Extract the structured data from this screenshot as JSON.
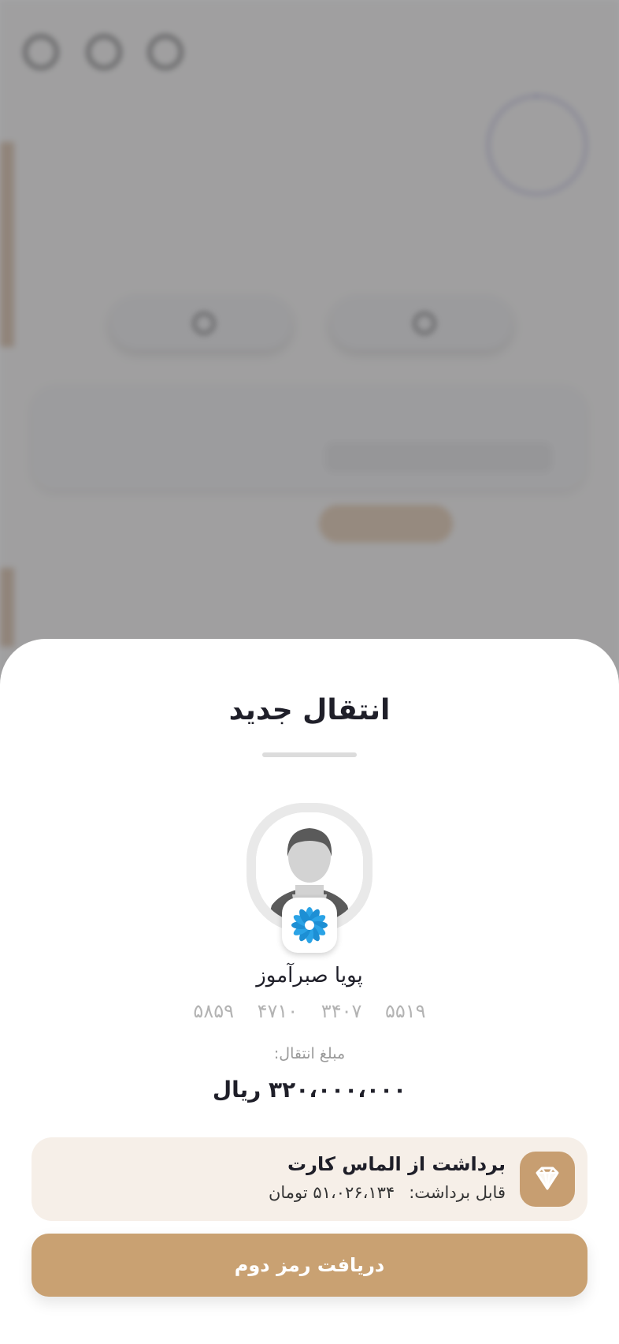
{
  "background": {
    "logo_text": "",
    "history_title": ""
  },
  "sheet": {
    "title": "انتقال جدید",
    "recipient": {
      "name": "پویا صبرآموز",
      "card_number": "۵۸۵۹ ۴۷۱۰ ۳۴۰۷ ۵۵۱۹"
    },
    "amount": {
      "label": "مبلغ انتقال:",
      "value": "۳۲۰،۰۰۰،۰۰۰ ریال"
    },
    "source": {
      "title": "برداشت از الماس کارت",
      "available_label": "قابل برداشت:",
      "available_value": "۵۱،۰۲۶،۱۳۴ تومان",
      "icon": "diamond-icon"
    },
    "action_label": "دریافت رمز دوم"
  },
  "colors": {
    "accent": "#c9a172",
    "source_bg": "#f6efe8",
    "title": "#1f1f29",
    "muted": "#b3b3b3"
  }
}
